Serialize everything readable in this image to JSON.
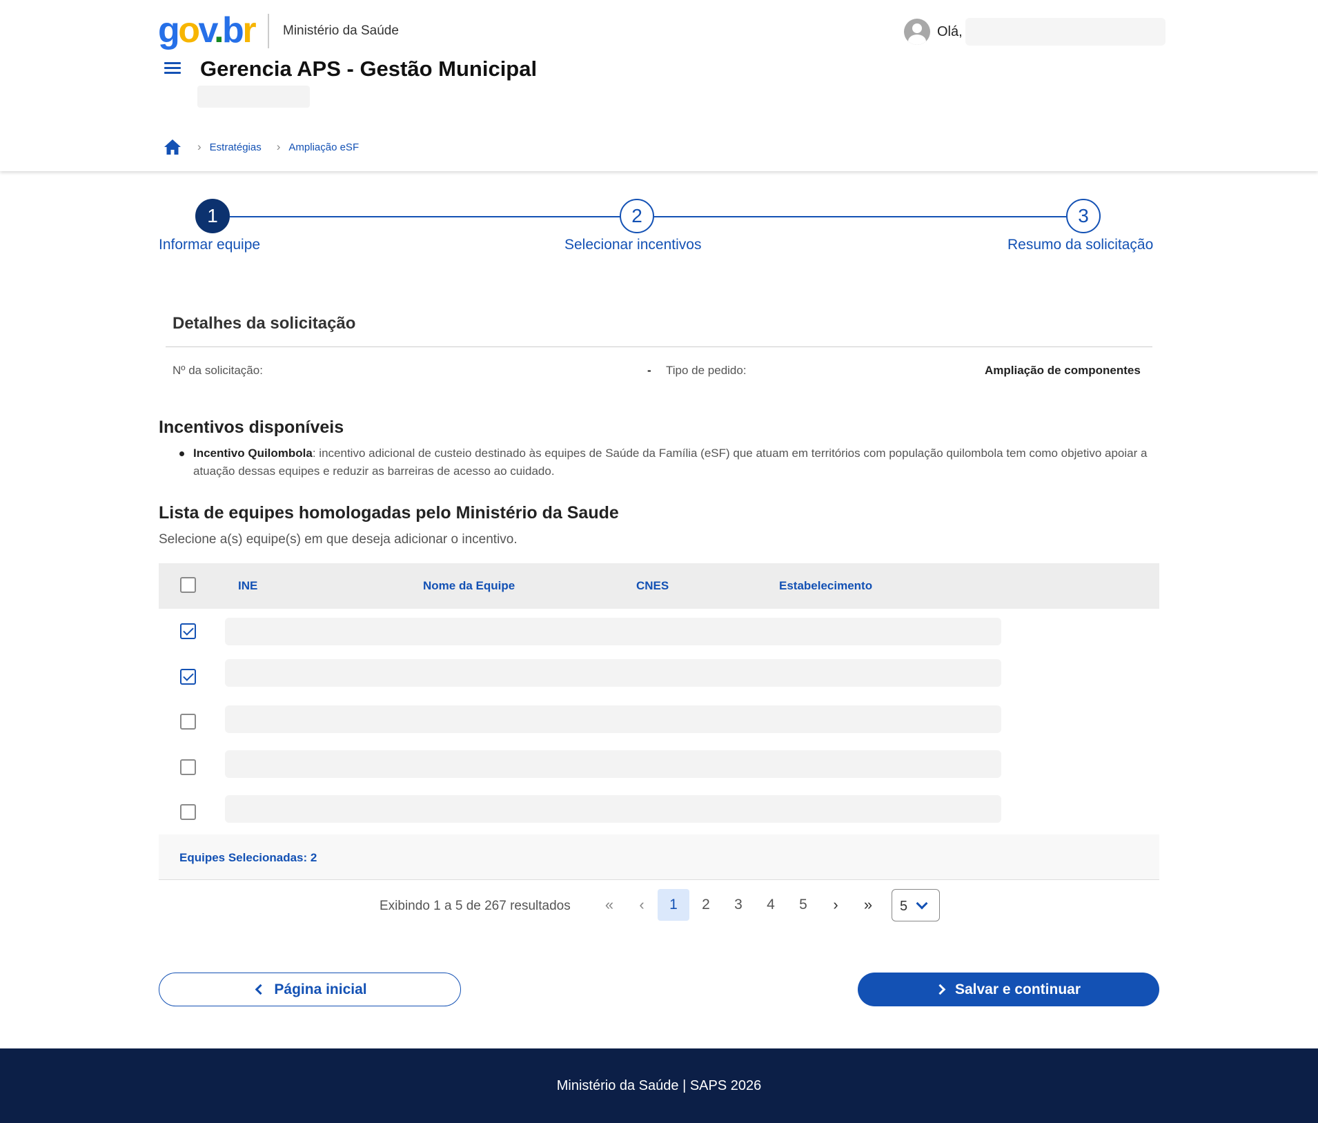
{
  "header": {
    "logo": {
      "g": "g",
      "o": "o",
      "v": "v",
      "dot": ".",
      "b": "b",
      "r": "r"
    },
    "org": "Ministério da Saúde",
    "greeting": "Olá,",
    "app_title": "Gerencia APS - Gestão Municipal"
  },
  "breadcrumb": {
    "items": [
      "Estratégias",
      "Ampliação eSF"
    ]
  },
  "stepper": {
    "steps": [
      {
        "number": "1",
        "label": "Informar equipe",
        "state": "active"
      },
      {
        "number": "2",
        "label": "Selecionar incentivos",
        "state": "pending"
      },
      {
        "number": "3",
        "label": "Resumo da solicitação",
        "state": "pending"
      }
    ]
  },
  "details": {
    "title": "Detalhes da solicitação",
    "request_no_label": "Nº da solicitação:",
    "request_no_value": "-",
    "type_label": "Tipo de pedido:",
    "type_value": "Ampliação de componentes"
  },
  "incentives": {
    "title": "Incentivos disponíveis",
    "items": [
      {
        "name": "Incentivo Quilombola",
        "description": ": incentivo adicional de custeio destinado às equipes de Saúde da Família (eSF) que atuam em territórios com população quilombola tem como objetivo apoiar a atuação dessas equipes e reduzir as barreiras de acesso ao cuidado."
      }
    ]
  },
  "teams": {
    "title": "Lista de equipes homologadas pelo Ministério da Saude",
    "subtitle": "Selecione a(s) equipe(s) em que deseja adicionar o incentivo.",
    "columns": [
      "INE",
      "Nome da Equipe",
      "CNES",
      "Estabelecimento"
    ],
    "rows_checked": [
      true,
      true,
      false,
      false,
      false
    ],
    "selected_count_label": "Equipes Selecionadas: 2"
  },
  "pagination": {
    "info": "Exibindo 1 a 5 de 267 resultados",
    "first": "«",
    "prev": "‹",
    "pages": [
      "1",
      "2",
      "3",
      "4",
      "5"
    ],
    "current_page": "1",
    "next": "›",
    "last": "»",
    "page_size": "5"
  },
  "buttons": {
    "back": "Página inicial",
    "save": "Salvar e continuar"
  },
  "footer": {
    "text": "Ministério da Saúde | SAPS 2026"
  },
  "colors": {
    "primary": "#1351b4",
    "primary_dark": "#0c326f",
    "footer_bg": "#0c1f47",
    "table_head_bg": "#ededed"
  }
}
